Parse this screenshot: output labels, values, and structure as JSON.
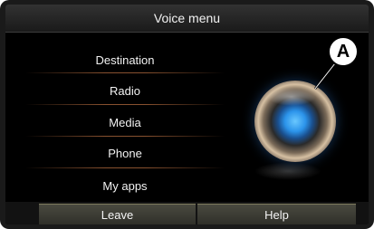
{
  "header": {
    "title": "Voice menu"
  },
  "menu": {
    "items": [
      {
        "label": "Destination"
      },
      {
        "label": "Radio"
      },
      {
        "label": "Media"
      },
      {
        "label": "Phone"
      },
      {
        "label": "My apps"
      }
    ]
  },
  "footer": {
    "leave_label": "Leave",
    "help_label": "Help"
  },
  "callout": {
    "label": "A"
  },
  "icons": {
    "orb": "voice-orb-icon"
  },
  "colors": {
    "accent_separator": "#a05f37",
    "orb_center": "#2b93ea"
  }
}
